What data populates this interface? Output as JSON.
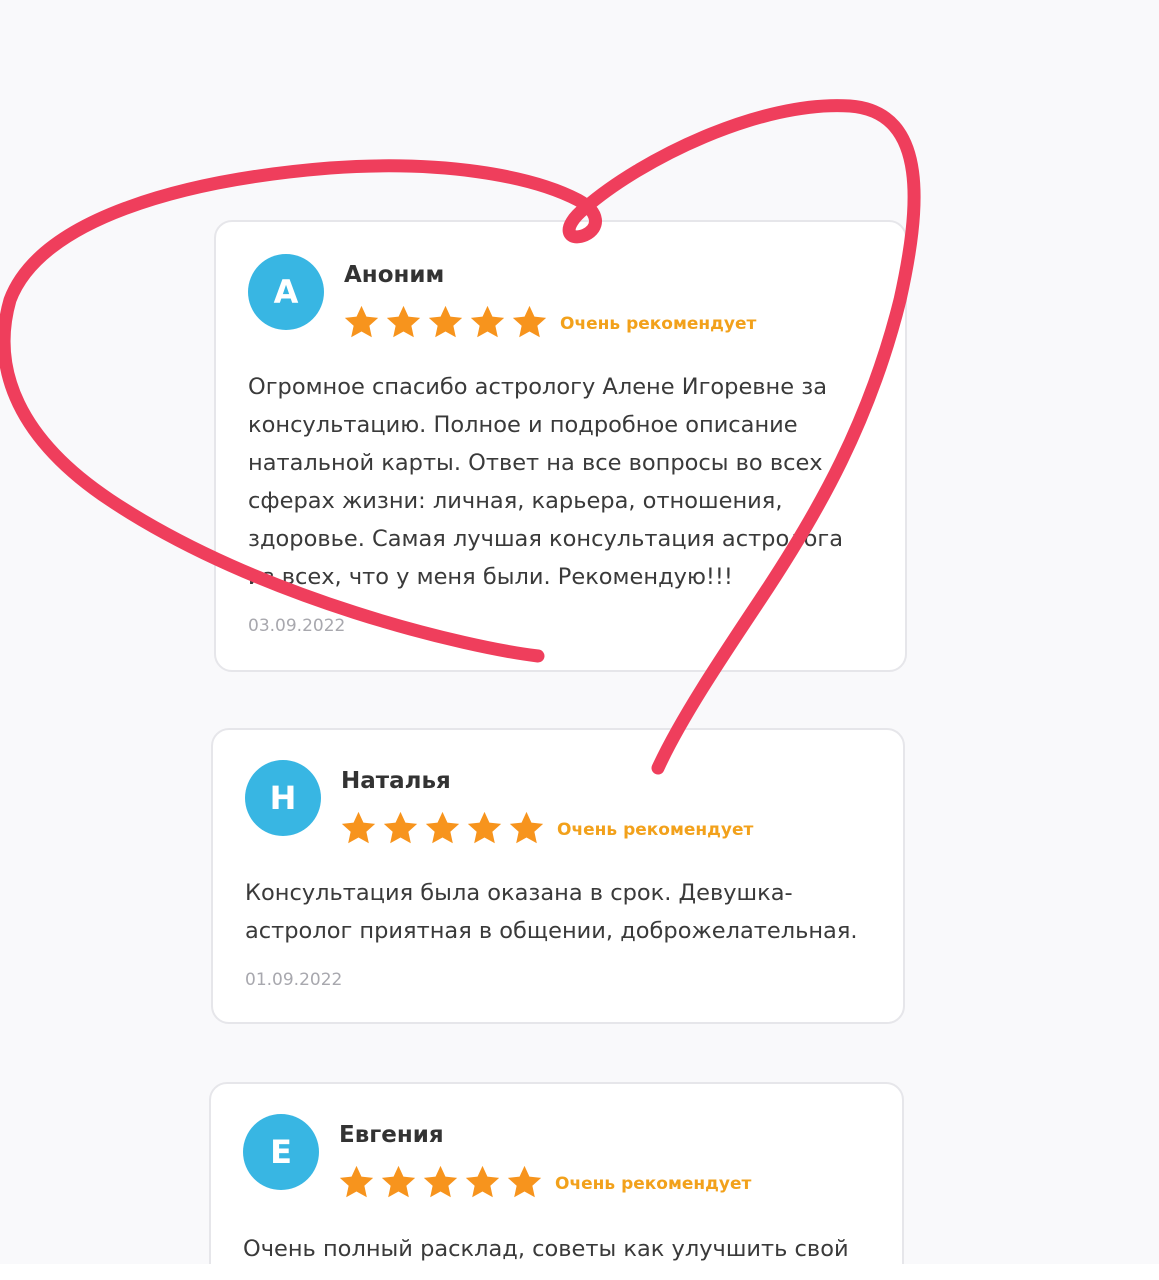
{
  "reviews": [
    {
      "initial": "А",
      "name": "Аноним",
      "rating": 5,
      "recommend": "Очень рекомендует",
      "text_lines": [
        "Огромное спасибо астрологу Алене Игоревне за",
        "консультацию. Полное и подробное описание",
        "натальной карты. Ответ на все вопросы во всех",
        "сферах жизни: личная, карьера, отношения,",
        "здоровье. Самая лучшая консультация астролога",
        "из всех, что у меня были. Рекомендую!!!"
      ],
      "date": "03.09.2022"
    },
    {
      "initial": "Н",
      "name": "Наталья",
      "rating": 5,
      "recommend": "Очень рекомендует",
      "text_lines": [
        "Консультация была оказана в срок. Девушка-",
        "астролог приятная в общении, доброжелательная."
      ],
      "date": "01.09.2022"
    },
    {
      "initial": "Е",
      "name": "Евгения",
      "rating": 5,
      "recommend": "Очень рекомендует",
      "text_lines": [
        "Очень полный расклад, советы как улучшить свой"
      ],
      "date": ""
    }
  ],
  "colors": {
    "avatar": "#38b6e3",
    "star": "#f7941d",
    "recommend": "#f2a11b",
    "heart": "#ef3e5c"
  },
  "icons": {
    "star": "star-icon",
    "heart": "heart-drawing"
  }
}
